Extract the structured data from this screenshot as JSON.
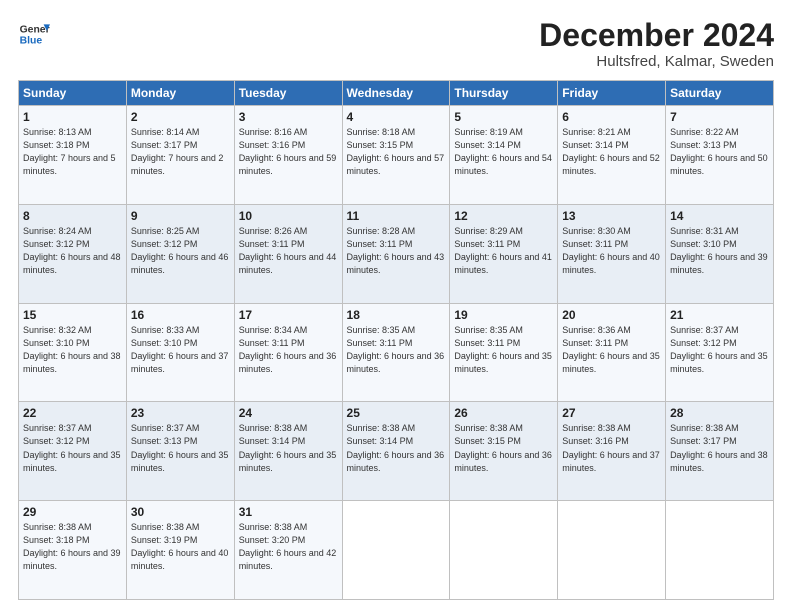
{
  "logo": {
    "general": "General",
    "blue": "Blue"
  },
  "title": "December 2024",
  "subtitle": "Hultsfred, Kalmar, Sweden",
  "headers": [
    "Sunday",
    "Monday",
    "Tuesday",
    "Wednesday",
    "Thursday",
    "Friday",
    "Saturday"
  ],
  "weeks": [
    [
      {
        "day": "1",
        "sunrise": "8:13 AM",
        "sunset": "3:18 PM",
        "daylight": "7 hours and 5 minutes."
      },
      {
        "day": "2",
        "sunrise": "8:14 AM",
        "sunset": "3:17 PM",
        "daylight": "7 hours and 2 minutes."
      },
      {
        "day": "3",
        "sunrise": "8:16 AM",
        "sunset": "3:16 PM",
        "daylight": "6 hours and 59 minutes."
      },
      {
        "day": "4",
        "sunrise": "8:18 AM",
        "sunset": "3:15 PM",
        "daylight": "6 hours and 57 minutes."
      },
      {
        "day": "5",
        "sunrise": "8:19 AM",
        "sunset": "3:14 PM",
        "daylight": "6 hours and 54 minutes."
      },
      {
        "day": "6",
        "sunrise": "8:21 AM",
        "sunset": "3:14 PM",
        "daylight": "6 hours and 52 minutes."
      },
      {
        "day": "7",
        "sunrise": "8:22 AM",
        "sunset": "3:13 PM",
        "daylight": "6 hours and 50 minutes."
      }
    ],
    [
      {
        "day": "8",
        "sunrise": "8:24 AM",
        "sunset": "3:12 PM",
        "daylight": "6 hours and 48 minutes."
      },
      {
        "day": "9",
        "sunrise": "8:25 AM",
        "sunset": "3:12 PM",
        "daylight": "6 hours and 46 minutes."
      },
      {
        "day": "10",
        "sunrise": "8:26 AM",
        "sunset": "3:11 PM",
        "daylight": "6 hours and 44 minutes."
      },
      {
        "day": "11",
        "sunrise": "8:28 AM",
        "sunset": "3:11 PM",
        "daylight": "6 hours and 43 minutes."
      },
      {
        "day": "12",
        "sunrise": "8:29 AM",
        "sunset": "3:11 PM",
        "daylight": "6 hours and 41 minutes."
      },
      {
        "day": "13",
        "sunrise": "8:30 AM",
        "sunset": "3:11 PM",
        "daylight": "6 hours and 40 minutes."
      },
      {
        "day": "14",
        "sunrise": "8:31 AM",
        "sunset": "3:10 PM",
        "daylight": "6 hours and 39 minutes."
      }
    ],
    [
      {
        "day": "15",
        "sunrise": "8:32 AM",
        "sunset": "3:10 PM",
        "daylight": "6 hours and 38 minutes."
      },
      {
        "day": "16",
        "sunrise": "8:33 AM",
        "sunset": "3:10 PM",
        "daylight": "6 hours and 37 minutes."
      },
      {
        "day": "17",
        "sunrise": "8:34 AM",
        "sunset": "3:11 PM",
        "daylight": "6 hours and 36 minutes."
      },
      {
        "day": "18",
        "sunrise": "8:35 AM",
        "sunset": "3:11 PM",
        "daylight": "6 hours and 36 minutes."
      },
      {
        "day": "19",
        "sunrise": "8:35 AM",
        "sunset": "3:11 PM",
        "daylight": "6 hours and 35 minutes."
      },
      {
        "day": "20",
        "sunrise": "8:36 AM",
        "sunset": "3:11 PM",
        "daylight": "6 hours and 35 minutes."
      },
      {
        "day": "21",
        "sunrise": "8:37 AM",
        "sunset": "3:12 PM",
        "daylight": "6 hours and 35 minutes."
      }
    ],
    [
      {
        "day": "22",
        "sunrise": "8:37 AM",
        "sunset": "3:12 PM",
        "daylight": "6 hours and 35 minutes."
      },
      {
        "day": "23",
        "sunrise": "8:37 AM",
        "sunset": "3:13 PM",
        "daylight": "6 hours and 35 minutes."
      },
      {
        "day": "24",
        "sunrise": "8:38 AM",
        "sunset": "3:14 PM",
        "daylight": "6 hours and 35 minutes."
      },
      {
        "day": "25",
        "sunrise": "8:38 AM",
        "sunset": "3:14 PM",
        "daylight": "6 hours and 36 minutes."
      },
      {
        "day": "26",
        "sunrise": "8:38 AM",
        "sunset": "3:15 PM",
        "daylight": "6 hours and 36 minutes."
      },
      {
        "day": "27",
        "sunrise": "8:38 AM",
        "sunset": "3:16 PM",
        "daylight": "6 hours and 37 minutes."
      },
      {
        "day": "28",
        "sunrise": "8:38 AM",
        "sunset": "3:17 PM",
        "daylight": "6 hours and 38 minutes."
      }
    ],
    [
      {
        "day": "29",
        "sunrise": "8:38 AM",
        "sunset": "3:18 PM",
        "daylight": "6 hours and 39 minutes."
      },
      {
        "day": "30",
        "sunrise": "8:38 AM",
        "sunset": "3:19 PM",
        "daylight": "6 hours and 40 minutes."
      },
      {
        "day": "31",
        "sunrise": "8:38 AM",
        "sunset": "3:20 PM",
        "daylight": "6 hours and 42 minutes."
      },
      null,
      null,
      null,
      null
    ]
  ]
}
